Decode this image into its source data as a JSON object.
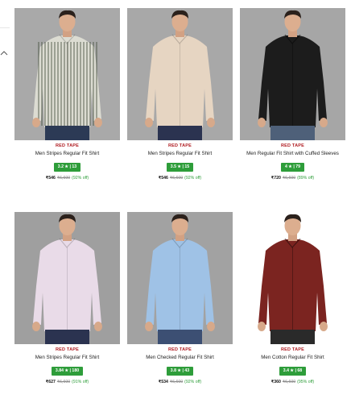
{
  "products": [
    {
      "brand": "RED TAPE",
      "name": "Men Stripes Regular Fit Shirt",
      "rating": "3.2 ★ | 13",
      "price": "₹546",
      "mrp": "₹6,600",
      "off": "(92% off)",
      "bg": "#a9a9a9",
      "shirt": "#dcdcd2",
      "stripes": true,
      "pants": "#2c3a55"
    },
    {
      "brand": "RED TAPE",
      "name": "Men Stripes Regular Fit Shirt",
      "rating": "3.5 ★ | 15",
      "price": "₹546",
      "mrp": "₹6,600",
      "off": "(92% off)",
      "bg": "#a8a8a8",
      "shirt": "#e6d5c2",
      "stripes": false,
      "pants": "#2b3350"
    },
    {
      "brand": "RED TAPE",
      "name": "Men Regular Fit Shirt with Cuffed Sleeves",
      "rating": "4 ★ | 79",
      "price": "₹720",
      "mrp": "₹6,600",
      "off": "(89% off)",
      "bg": "#a6a6a6",
      "shirt": "#1c1c1c",
      "stripes": false,
      "pants": "#4e6079"
    },
    {
      "brand": "RED TAPE",
      "name": "Men Stripes Regular Fit Shirt",
      "rating": "3.84 ★ | 180",
      "price": "₹627",
      "mrp": "₹6,600",
      "off": "(91% off)",
      "bg": "#9f9f9f",
      "shirt": "#e9dbe8",
      "stripes": false,
      "pants": "#2b3350"
    },
    {
      "brand": "RED TAPE",
      "name": "Men Checked Regular Fit Shirt",
      "rating": "3.8 ★ | 43",
      "price": "₹534",
      "mrp": "₹6,600",
      "off": "(92% off)",
      "bg": "#a2a2a2",
      "shirt": "#9fc2e6",
      "stripes": false,
      "pants": "#3c4f73"
    },
    {
      "brand": "RED TAPE",
      "name": "Men Cotton Regular Fit Shirt",
      "rating": "3.4 ★ | 68",
      "price": "₹360",
      "mrp": "₹6,600",
      "off": "(95% off)",
      "bg": "#ffffff",
      "shirt": "#7b2420",
      "stripes": false,
      "pants": "#2a2a2a"
    }
  ]
}
